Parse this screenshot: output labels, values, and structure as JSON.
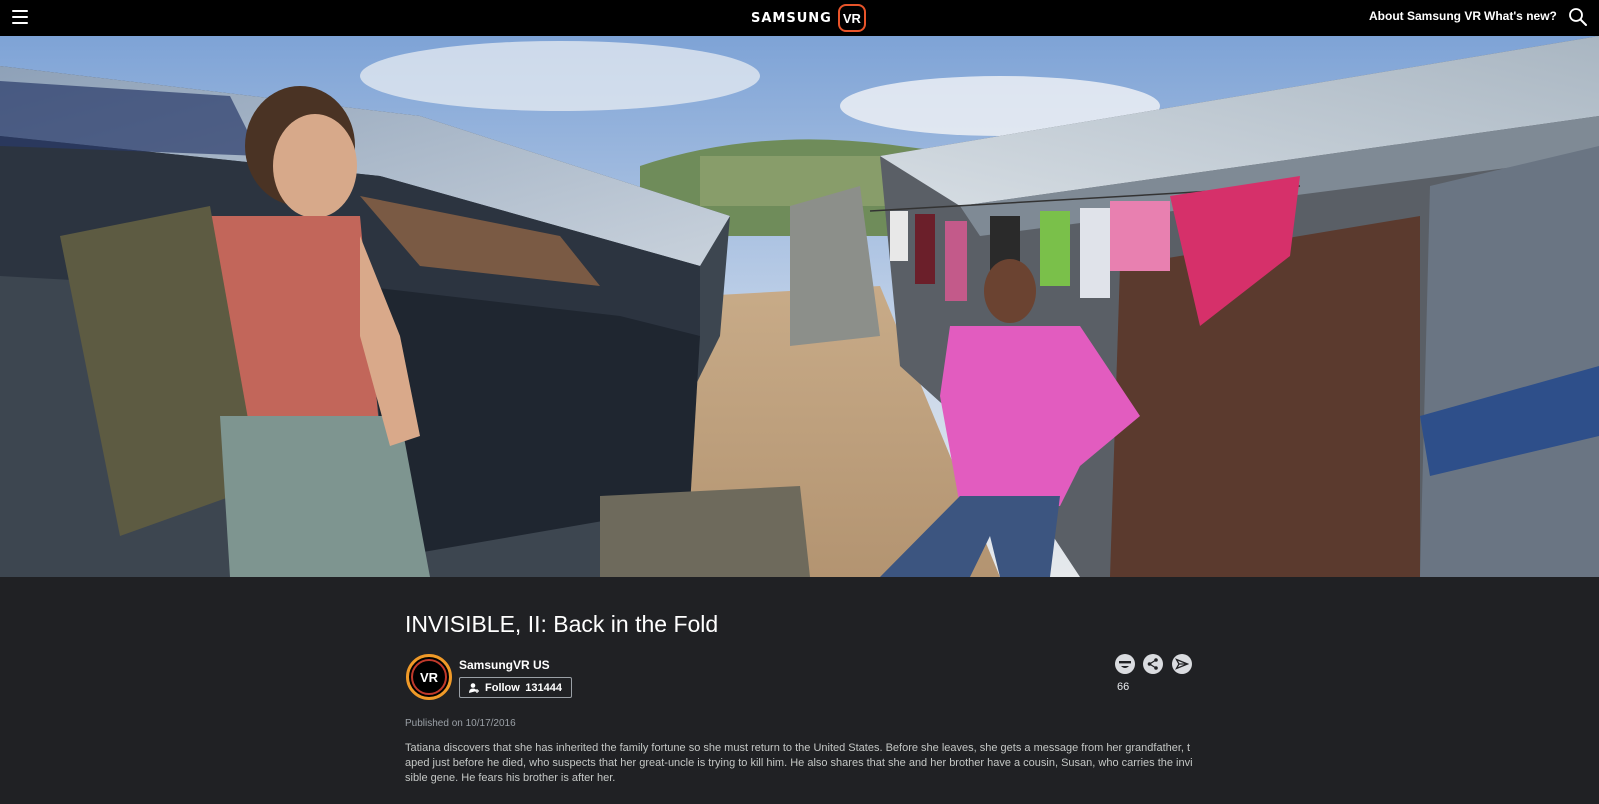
{
  "header": {
    "brand_word": "SAMSUNG",
    "brand_badge": "VR",
    "nav": [
      "About Samsung VR",
      "What's new?"
    ],
    "icons": {
      "menu": "hamburger-menu-icon",
      "search": "search-icon"
    }
  },
  "hero": {
    "image": "360 video still: two women standing between tin-roof shanty shelters under a blue sky"
  },
  "video": {
    "title": "INVISIBLE, II: Back in the Fold",
    "channel": {
      "avatar_text": "VR",
      "name": "SamsungVR US",
      "follow_label": "Follow",
      "follower_count": "131444"
    },
    "reactions": {
      "count": "66",
      "icons": [
        "reaction-face-icon",
        "share-icon",
        "send-icon"
      ]
    },
    "published": "Published on 10/17/2016",
    "description": "Tatiana discovers that she has inherited the family fortune so she must return to the United States. Before she leaves, she gets a message from her grandfather, taped just before he died, who suspects that her great-uncle is trying to kill him. He also shares that she and her brother have a cousin, Susan, who carries the invisible gene. He fears his brother is after her."
  },
  "colors": {
    "topbar": "#000000",
    "page_bg": "#202124",
    "accent_orange": "#f09a28",
    "accent_red": "#c0392b"
  }
}
